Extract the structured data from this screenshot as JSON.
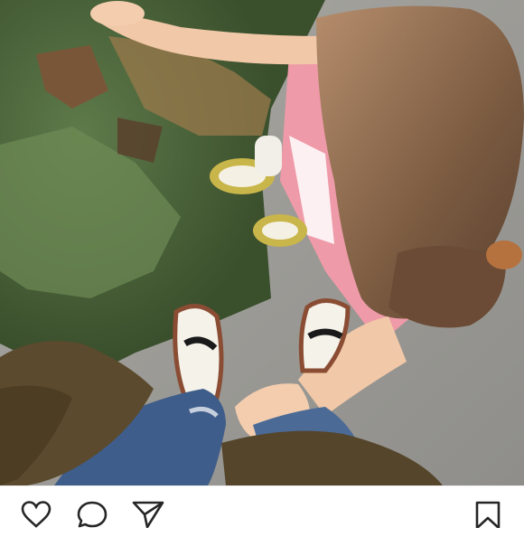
{
  "post": {
    "photo_alt_hidden": "",
    "actions": [
      {
        "name": "like",
        "icon": "heart-icon"
      },
      {
        "name": "comment",
        "icon": "comment-icon"
      },
      {
        "name": "share",
        "icon": "send-icon"
      },
      {
        "name": "save",
        "icon": "bookmark-icon"
      }
    ],
    "colors": {
      "icon_stroke": "#262626",
      "background": "#ffffff"
    }
  }
}
